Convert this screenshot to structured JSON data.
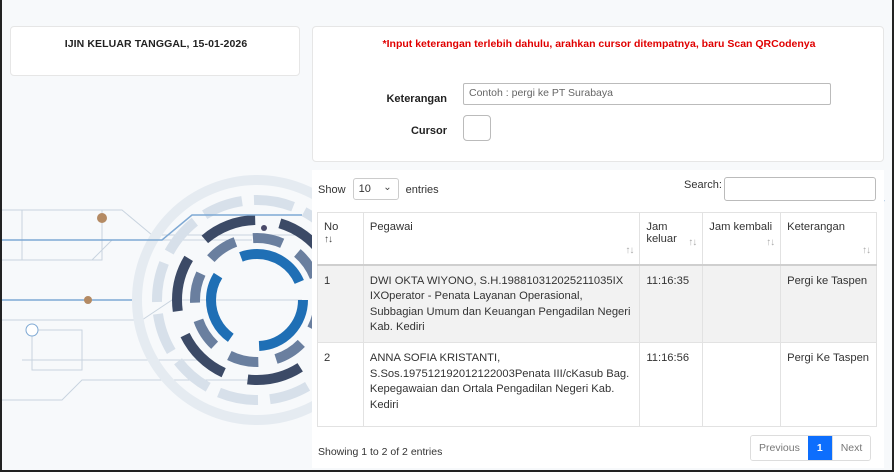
{
  "header": {
    "title": "IJIN KELUAR TANGGAL, 15-01-2026"
  },
  "form": {
    "notice": "*Input keterangan terlebih dahulu, arahkan cursor ditempatnya, baru Scan QRCodenya",
    "keterangan_label": "Keterangan",
    "keterangan_placeholder": "Contoh : pergi ke PT Surabaya",
    "cursor_label": "Cursor"
  },
  "table_controls": {
    "show_label": "Show",
    "entries_value": "10",
    "entries_label": "entries",
    "search_label": "Search:"
  },
  "table": {
    "columns": [
      "No",
      "Pegawai",
      "Jam keluar",
      "Jam kembali",
      "Keterangan"
    ],
    "rows": [
      {
        "no": "1",
        "pegawai": "DWI OKTA WIYONO, S.H.198810312025211035IX IXOperator - Penata Layanan Operasional, Subbagian Umum dan Keuangan Pengadilan Negeri Kab. Kediri",
        "jam_keluar": "11:16:35",
        "jam_kembali": "",
        "keterangan": "Pergi ke Taspen"
      },
      {
        "no": "2",
        "pegawai": "ANNA SOFIA KRISTANTI, S.Sos.197512192012122003Penata III/cKasub Bag. Kepegawaian dan Ortala Pengadilan Negeri Kab. Kediri",
        "jam_keluar": "11:16:56",
        "jam_kembali": "",
        "keterangan": "Pergi Ke Taspen"
      }
    ]
  },
  "footer": {
    "info": "Showing 1 to 2 of 2 entries",
    "previous_label": "Previous",
    "current_page": "1",
    "next_label": "Next"
  },
  "colors": {
    "notice": "#e00000",
    "page_active": "#0d6efd"
  }
}
